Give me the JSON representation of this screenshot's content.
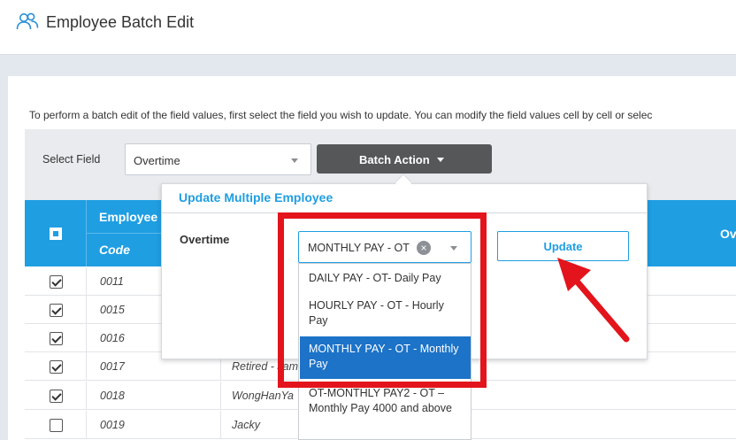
{
  "header": {
    "title": "Employee Batch Edit",
    "icon": "users-icon"
  },
  "instructions": "To perform a batch edit of the field values, first select the field you wish to update. You can modify the field values cell by cell or selec",
  "toolbar": {
    "select_field_label": "Select Field",
    "field_value": "Overtime",
    "batch_action_label": "Batch Action"
  },
  "table": {
    "header_employee": "Employee",
    "header_code": "Code",
    "header_overtime": "Ov",
    "rows": [
      {
        "checked": true,
        "code": "0011",
        "name": ""
      },
      {
        "checked": true,
        "code": "0015",
        "name": ""
      },
      {
        "checked": true,
        "code": "0016",
        "name": ""
      },
      {
        "checked": true,
        "code": "0017",
        "name": "Retired - Jam"
      },
      {
        "checked": true,
        "code": "0018",
        "name": "WongHanYa"
      },
      {
        "checked": false,
        "code": "0019",
        "name": "Jacky"
      }
    ]
  },
  "popup": {
    "title": "Update Multiple Employee",
    "field_label": "Overtime",
    "selected_value": "MONTHLY PAY - OT",
    "update_label": "Update",
    "options": [
      {
        "label": "DAILY PAY - OT- Daily Pay",
        "selected": false
      },
      {
        "label": "HOURLY PAY - OT - Hourly Pay",
        "selected": false
      },
      {
        "label": "MONTHLY PAY - OT - Monthly Pay",
        "selected": true
      },
      {
        "label": "OT-MONTHLY PAY2 - OT – Monthly Pay 4000 and above",
        "selected": false
      }
    ]
  },
  "colors": {
    "accent": "#1f9ee2",
    "selected_option": "#1c73c8",
    "annotation": "#e3141b",
    "batch_button": "#555759"
  }
}
